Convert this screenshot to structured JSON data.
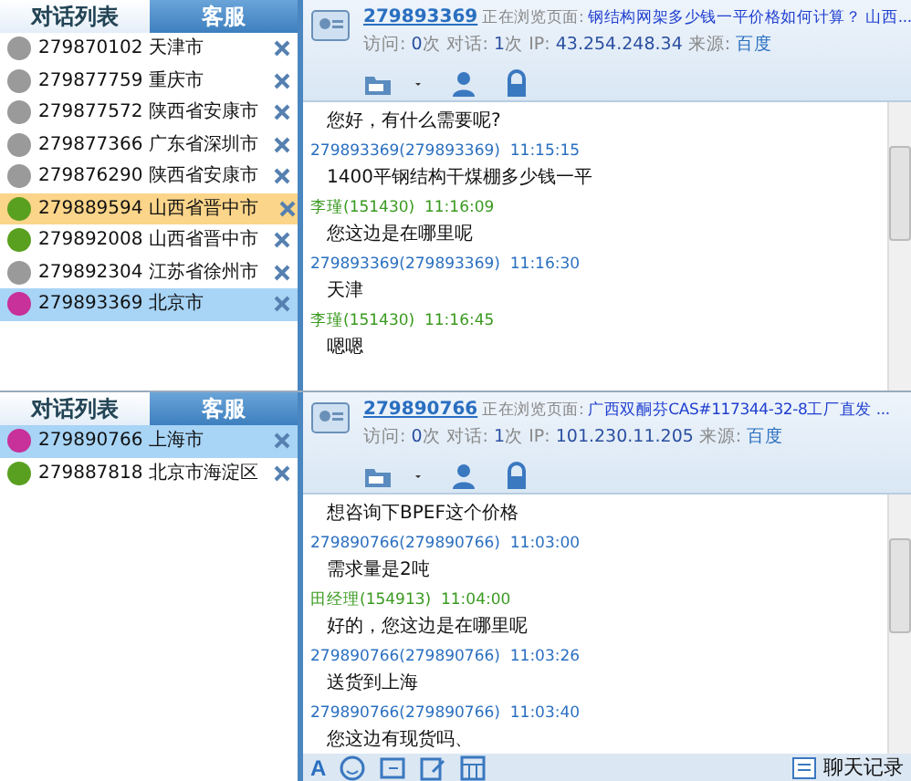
{
  "panels": [
    {
      "tabs": [
        {
          "label": "对话列表",
          "selected": true
        },
        {
          "label": "客服",
          "selected": false
        }
      ],
      "conversations": [
        {
          "id": "279870102",
          "location": "天津市",
          "color": "#9a9a9a",
          "selected": false,
          "alert": false
        },
        {
          "id": "279877759",
          "location": "重庆市",
          "color": "#9a9a9a",
          "selected": false,
          "alert": false
        },
        {
          "id": "279877572",
          "location": "陕西省安康市",
          "color": "#9a9a9a",
          "selected": false,
          "alert": false
        },
        {
          "id": "279877366",
          "location": "广东省深圳市",
          "color": "#9a9a9a",
          "selected": false,
          "alert": false
        },
        {
          "id": "279876290",
          "location": "陕西省安康市",
          "color": "#9a9a9a",
          "selected": false,
          "alert": false
        },
        {
          "id": "279889594",
          "location": "山西省晋中市",
          "color": "#5aa020",
          "selected": false,
          "alert": true
        },
        {
          "id": "279892008",
          "location": "山西省晋中市",
          "color": "#5aa020",
          "selected": false,
          "alert": false
        },
        {
          "id": "279892304",
          "location": "江苏省徐州市",
          "color": "#9a9a9a",
          "selected": false,
          "alert": false
        },
        {
          "id": "279893369",
          "location": "北京市",
          "color": "#c8309a",
          "selected": true,
          "alert": false
        }
      ],
      "visitor": {
        "id": "279893369",
        "viewing_label": "正在浏览页面:",
        "page_title": "钢结构网架多少钱一平价格如何计算？ 山西...",
        "info": [
          {
            "text": "访问: ",
            "kind": "label"
          },
          {
            "text": "0",
            "kind": "value"
          },
          {
            "text": "次 对话: ",
            "kind": "label"
          },
          {
            "text": "1",
            "kind": "value"
          },
          {
            "text": "次 IP: ",
            "kind": "label"
          },
          {
            "text": "43.254.248.34",
            "kind": "value"
          },
          {
            "text": " 来源: ",
            "kind": "label"
          },
          {
            "text": "百度",
            "kind": "link"
          }
        ]
      },
      "messages": [
        {
          "kind": "body",
          "text": "您好，有什么需要呢?"
        },
        {
          "kind": "visitor",
          "text": "279893369(279893369)  11:15:15"
        },
        {
          "kind": "body",
          "text": "1400平钢结构干煤棚多少钱一平"
        },
        {
          "kind": "agent",
          "text": "李瑾(151430)  11:16:09"
        },
        {
          "kind": "body",
          "text": "您这边是在哪里呢"
        },
        {
          "kind": "visitor",
          "text": "279893369(279893369)  11:16:30"
        },
        {
          "kind": "body",
          "text": "天津"
        },
        {
          "kind": "agent",
          "text": "李瑾(151430)  11:16:45"
        },
        {
          "kind": "body",
          "text": "嗯嗯"
        }
      ]
    },
    {
      "tabs": [
        {
          "label": "对话列表",
          "selected": true
        },
        {
          "label": "客服",
          "selected": false
        }
      ],
      "conversations": [
        {
          "id": "279890766",
          "location": "上海市",
          "color": "#c8309a",
          "selected": true,
          "alert": false
        },
        {
          "id": "279887818",
          "location": "北京市海淀区",
          "color": "#5aa020",
          "selected": false,
          "alert": false
        }
      ],
      "visitor": {
        "id": "279890766",
        "viewing_label": "正在浏览页面:",
        "page_title": "广西双酮芬CAS#117344-32-8工厂直发 ...",
        "info": [
          {
            "text": "访问: ",
            "kind": "label"
          },
          {
            "text": "0",
            "kind": "value"
          },
          {
            "text": "次 对话: ",
            "kind": "label"
          },
          {
            "text": "1",
            "kind": "value"
          },
          {
            "text": "次 IP: ",
            "kind": "label"
          },
          {
            "text": "101.230.11.205",
            "kind": "value"
          },
          {
            "text": " 来源: ",
            "kind": "label"
          },
          {
            "text": "百度",
            "kind": "link"
          }
        ]
      },
      "messages": [
        {
          "kind": "body",
          "text": "想咨询下BPEF这个价格"
        },
        {
          "kind": "visitor",
          "text": "279890766(279890766)  11:03:00"
        },
        {
          "kind": "body",
          "text": "需求量是2吨"
        },
        {
          "kind": "agent",
          "text": "田经理(154913)  11:04:00"
        },
        {
          "kind": "body",
          "text": "好的，您这边是在哪里呢"
        },
        {
          "kind": "visitor",
          "text": "279890766(279890766)  11:03:26"
        },
        {
          "kind": "body",
          "text": "送货到上海"
        },
        {
          "kind": "visitor",
          "text": "279890766(279890766)  11:03:40"
        },
        {
          "kind": "body",
          "text": "您这边有现货吗、"
        }
      ],
      "footer": {
        "font_button": "A",
        "history_label": "聊天记录"
      }
    }
  ]
}
